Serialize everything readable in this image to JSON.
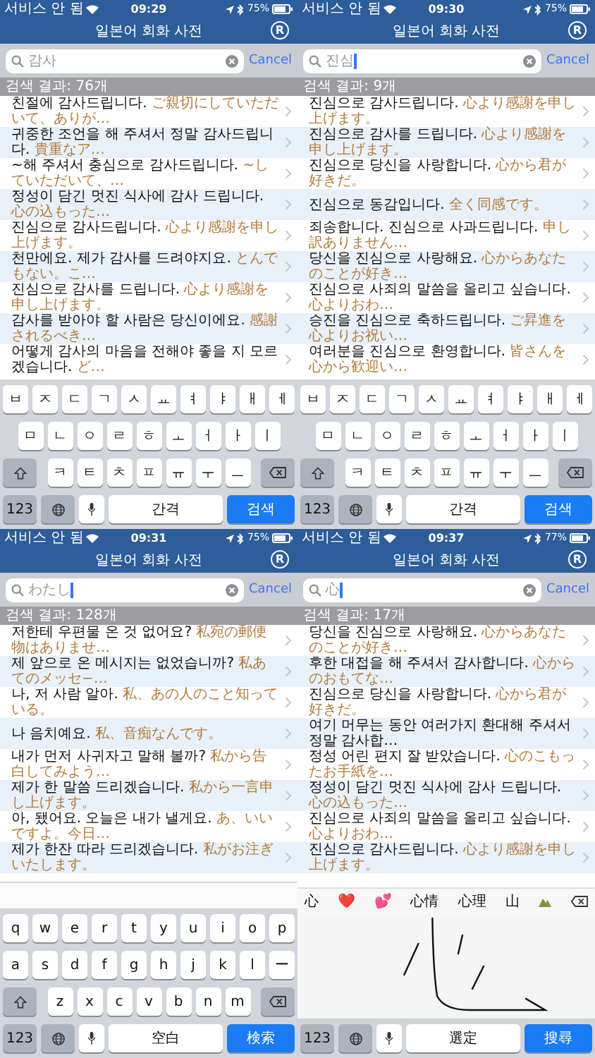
{
  "panels": [
    {
      "status": {
        "carrier": "서비스 안 됨",
        "time": "09:29",
        "battery": "75%"
      },
      "nav": {
        "title": "일본어 회화 사전",
        "logo": "R"
      },
      "search": {
        "query": "감사",
        "focused": false,
        "cancel": "Cancel"
      },
      "count": "검색 결과: 76개",
      "rows": [
        {
          "ko": "친절에 감사드립니다.",
          "ja": "ご親切にしていただいて、ありが…"
        },
        {
          "ko": "귀중한 조언을 해 주셔서 정말 감사드립니다.",
          "ja": "貴重なア…"
        },
        {
          "ko": "~해 주셔서 충심으로 감사드립니다.",
          "ja": "~していただいて、…"
        },
        {
          "ko": "정성이 담긴 멋진 식사에 감사 드립니다.",
          "ja": "心の込もった…"
        },
        {
          "ko": "진심으로 감사드립니다.",
          "ja": "心より感謝を申し上げます。"
        },
        {
          "ko": "천만에요. 제가 감사를 드려야지요.",
          "ja": "とんでもない。こ…"
        },
        {
          "ko": "진심으로 감사를 드립니다.",
          "ja": "心より感謝を申し上げます。"
        },
        {
          "ko": "감사를 받아야 할 사람은 당신이에요.",
          "ja": "感謝されるべき…"
        },
        {
          "ko": "어떻게 감사의 마음을 전해야 좋을 지 모르겠습니다.",
          "ja": "ど…"
        }
      ],
      "keyboard": {
        "kind": "hangul",
        "rows": [
          [
            "ㅂ",
            "ㅈ",
            "ㄷ",
            "ㄱ",
            "ㅅ",
            "ㅛ",
            "ㅕ",
            "ㅑ",
            "ㅐ",
            "ㅔ"
          ],
          [
            "ㅁ",
            "ㄴ",
            "ㅇ",
            "ㄹ",
            "ㅎ",
            "ㅗ",
            "ㅓ",
            "ㅏ",
            "ㅣ"
          ],
          [
            "ㅋ",
            "ㅌ",
            "ㅊ",
            "ㅍ",
            "ㅠ",
            "ㅜ",
            "ㅡ"
          ]
        ],
        "numbers": "123",
        "space": "간격",
        "action": "검색"
      }
    },
    {
      "status": {
        "carrier": "서비스 안 됨",
        "time": "09:30",
        "battery": "75%"
      },
      "nav": {
        "title": "일본어 회화 사전",
        "logo": "R"
      },
      "search": {
        "query": "진심",
        "focused": true,
        "cancel": "Cancel"
      },
      "count": "검색 결과: 9개",
      "rows": [
        {
          "ko": "진심으로 감사드립니다.",
          "ja": "心より感謝を申し上げます。"
        },
        {
          "ko": "진심으로 감사를 드립니다.",
          "ja": "心より感謝を申し上げます。"
        },
        {
          "ko": "진심으로 당신을 사랑합니다.",
          "ja": "心から君が好きだ。"
        },
        {
          "ko": "진심으로 동감입니다.",
          "ja": "全く同感です。"
        },
        {
          "ko": "죄송합니다. 진심으로 사과드립니다.",
          "ja": "申し訳ありません…"
        },
        {
          "ko": "당신을 진심으로 사랑해요.",
          "ja": "心からあなたのことが好き…"
        },
        {
          "ko": "진심으로 사죄의 말씀을 올리고 싶습니다.",
          "ja": "心よりおわ…"
        },
        {
          "ko": "승진을 진심으로 축하드립니다.",
          "ja": "ご昇進を心よりお祝い…"
        },
        {
          "ko": "여러분을 진심으로 환영합니다.",
          "ja": "皆さんを心から歓迎い…"
        }
      ],
      "keyboard": {
        "kind": "hangul",
        "rows": [
          [
            "ㅂ",
            "ㅈ",
            "ㄷ",
            "ㄱ",
            "ㅅ",
            "ㅛ",
            "ㅕ",
            "ㅑ",
            "ㅐ",
            "ㅔ"
          ],
          [
            "ㅁ",
            "ㄴ",
            "ㅇ",
            "ㄹ",
            "ㅎ",
            "ㅗ",
            "ㅓ",
            "ㅏ",
            "ㅣ"
          ],
          [
            "ㅋ",
            "ㅌ",
            "ㅊ",
            "ㅍ",
            "ㅠ",
            "ㅜ",
            "ㅡ"
          ]
        ],
        "numbers": "123",
        "space": "간격",
        "action": "검색"
      }
    },
    {
      "status": {
        "carrier": "서비스 안 됨",
        "time": "09:31",
        "battery": "75%"
      },
      "nav": {
        "title": "일본어 회화 사전",
        "logo": "R"
      },
      "search": {
        "query": "わたし",
        "focused": true,
        "cancel": "Cancel"
      },
      "count": "검색 결과: 128개",
      "rows": [
        {
          "ko": "저한테 우편물 온 것 없어요?",
          "ja": "私宛の郵便物はありませ…"
        },
        {
          "ko": "제 앞으로 온 메시지는 없었습니까?",
          "ja": "私あてのメッセ−…"
        },
        {
          "ko": "나, 저 사람 알아.",
          "ja": "私、あの人のこと知っている。"
        },
        {
          "ko": "나 음치예요.",
          "ja": "私、音痴なんです。"
        },
        {
          "ko": "내가 먼저 사귀자고 말해 볼까?",
          "ja": "私から告白してみよう…"
        },
        {
          "ko": "제가 한 말씀 드리겠습니다.",
          "ja": "私から一言申し上げます。"
        },
        {
          "ko": "아, 됐어요. 오늘은 내가 낼게요.",
          "ja": "あ、いいですよ。今日…"
        },
        {
          "ko": "제가 한잔 따라 드리겠습니다.",
          "ja": "私がお注ぎいたします。"
        }
      ],
      "keyboard": {
        "kind": "kana",
        "rows": [
          [
            "q",
            "w",
            "e",
            "r",
            "t",
            "y",
            "u",
            "i",
            "o",
            "p"
          ],
          [
            "a",
            "s",
            "d",
            "f",
            "g",
            "h",
            "j",
            "k",
            "l",
            "ー"
          ],
          [
            "z",
            "x",
            "c",
            "v",
            "b",
            "n",
            "m"
          ]
        ],
        "numbers": "123",
        "space": "空白",
        "action": "検索"
      }
    },
    {
      "status": {
        "carrier": "서비스 안 됨",
        "time": "09:37",
        "battery": "77%"
      },
      "nav": {
        "title": "일본어 회화 사전",
        "logo": "R"
      },
      "search": {
        "query": "心",
        "focused": true,
        "cancel": "Cancel"
      },
      "count": "검색 결과: 17개",
      "rows": [
        {
          "ko": "당신을 진심으로 사랑해요.",
          "ja": "心からあなたのことが好き…"
        },
        {
          "ko": "후한 대접을 해 주셔서 감사합니다.",
          "ja": "心からのおもてな…"
        },
        {
          "ko": "진심으로 당신을 사랑합니다.",
          "ja": "心から君が好きだ。"
        },
        {
          "ko": "여기 머무는 동안 여러가지 환대해 주셔서 정말 감사합…"
        },
        {
          "ko": "정성 어린 편지 잘 받았습니다.",
          "ja": "心のこもったお手紙を…"
        },
        {
          "ko": "정성이 담긴 멋진 식사에 감사 드립니다.",
          "ja": "心の込もった…"
        },
        {
          "ko": "진심으로 사죄의 말씀을 올리고 싶습니다.",
          "ja": "心よりおわ…"
        },
        {
          "ko": "진심으로 감사드립니다.",
          "ja": "心より感謝を申し上げます。"
        }
      ],
      "keyboard": {
        "kind": "handwriting",
        "candidates": [
          "心",
          "❤️",
          "💕",
          "心情",
          "心理",
          "山"
        ],
        "numbers": "123",
        "space": "選定",
        "action": "搜尋"
      }
    }
  ]
}
